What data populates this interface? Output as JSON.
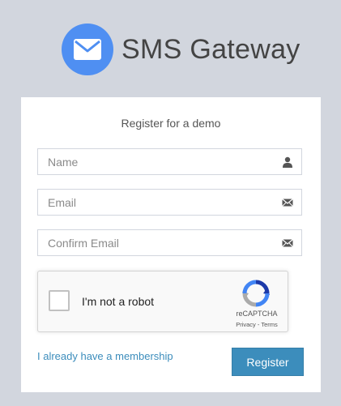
{
  "brand": {
    "name": "SMS Gateway",
    "logo_icon": "envelope-icon",
    "logo_color": "#4f8ff2"
  },
  "form": {
    "title": "Register for a demo",
    "name_placeholder": "Name",
    "name_icon": "user-icon",
    "email_placeholder": "Email",
    "email_icon": "envelope-icon",
    "confirm_email_placeholder": "Confirm Email",
    "confirm_email_icon": "envelope-icon"
  },
  "captcha": {
    "label": "I'm not a robot",
    "brand": "reCAPTCHA",
    "privacy": "Privacy",
    "separator": " - ",
    "terms": "Terms"
  },
  "actions": {
    "membership_link": "I already have a membership",
    "register_label": "Register",
    "primary_color": "#3c8dbc"
  },
  "colors": {
    "page_background": "#d2d6de",
    "card_background": "#ffffff"
  }
}
